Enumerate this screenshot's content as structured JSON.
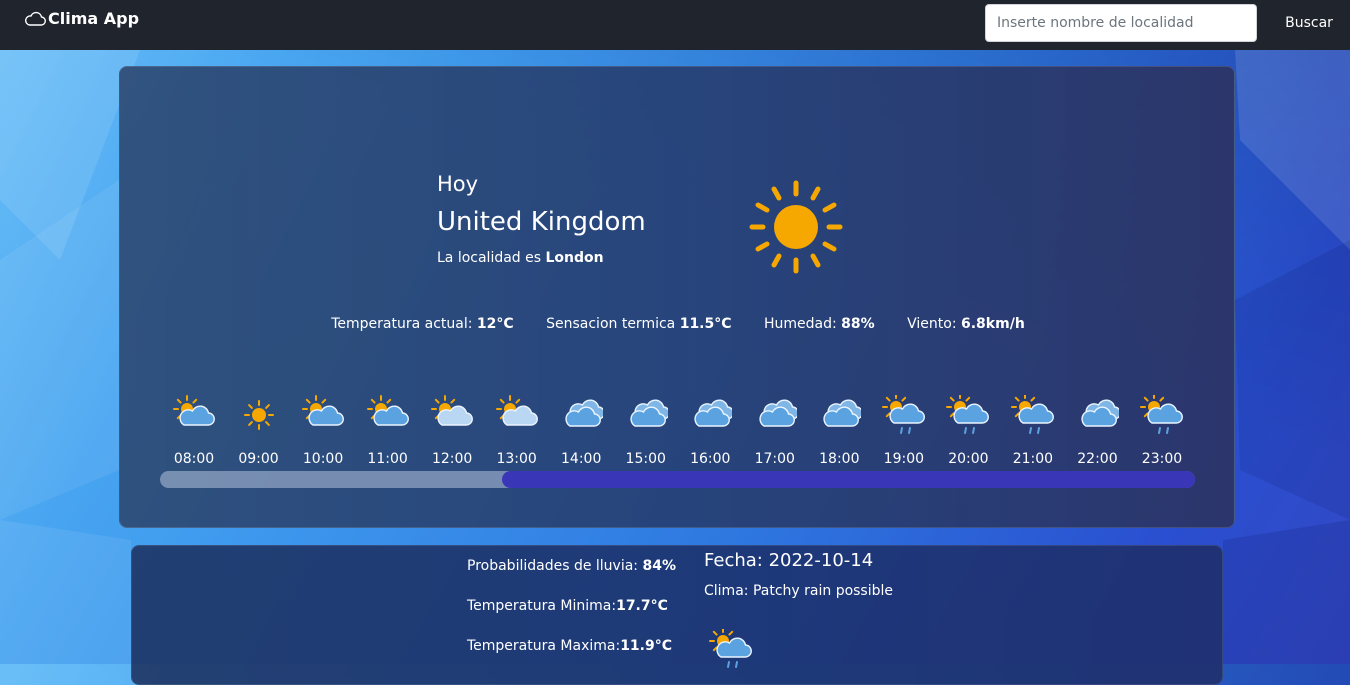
{
  "app": {
    "title": "Clima App",
    "brand_icon": "cloud-icon"
  },
  "search": {
    "placeholder": "Inserte nombre de localidad",
    "value": "",
    "button_label": "Buscar"
  },
  "current": {
    "day_label": "Hoy",
    "country": "United Kingdom",
    "locality_prefix": "La localidad es ",
    "locality": "London",
    "condition_icon": "sun-icon",
    "stats": [
      {
        "label": "Temperatura actual: ",
        "value": "12°C"
      },
      {
        "label": "Sensacion termica ",
        "value": "11.5°C"
      },
      {
        "label": "Humedad: ",
        "value": "88%"
      },
      {
        "label": "Viento: ",
        "value": "6.8km/h"
      }
    ]
  },
  "hourly": [
    {
      "time": "08:00",
      "icon": "partly-cloudy-icon"
    },
    {
      "time": "09:00",
      "icon": "sun-icon"
    },
    {
      "time": "10:00",
      "icon": "partly-cloudy-icon"
    },
    {
      "time": "11:00",
      "icon": "partly-cloudy-icon"
    },
    {
      "time": "12:00",
      "icon": "partly-cloudy-light-icon"
    },
    {
      "time": "13:00",
      "icon": "partly-cloudy-light-icon"
    },
    {
      "time": "14:00",
      "icon": "cloudy-icon"
    },
    {
      "time": "15:00",
      "icon": "cloudy-icon"
    },
    {
      "time": "16:00",
      "icon": "cloudy-icon"
    },
    {
      "time": "17:00",
      "icon": "cloudy-icon"
    },
    {
      "time": "18:00",
      "icon": "cloudy-icon"
    },
    {
      "time": "19:00",
      "icon": "patchy-rain-icon"
    },
    {
      "time": "20:00",
      "icon": "patchy-rain-icon"
    },
    {
      "time": "21:00",
      "icon": "patchy-rain-icon"
    },
    {
      "time": "22:00",
      "icon": "cloudy-icon"
    },
    {
      "time": "23:00",
      "icon": "patchy-rain-icon"
    }
  ],
  "hourly_scroll": {
    "position_fraction": 0.33,
    "visible_fraction": 0.67
  },
  "forecast": {
    "rain_label": "Probabilidades de lluvia: ",
    "rain_value": "84%",
    "min_label": "Temperatura Minima:",
    "min_value": "17.7°C",
    "max_label": "Temperatura Maxima:",
    "max_value": "11.9°C",
    "date_label": "Fecha: ",
    "date": "2022-10-14",
    "condition_label": "Clima: ",
    "condition": "Patchy rain possible",
    "condition_icon": "patchy-rain-icon"
  },
  "colors": {
    "navbar": "#1f242d",
    "sun": "#f7a800",
    "cloud": "#5ba3e0",
    "scroll_thumb": "#3a36b8"
  }
}
